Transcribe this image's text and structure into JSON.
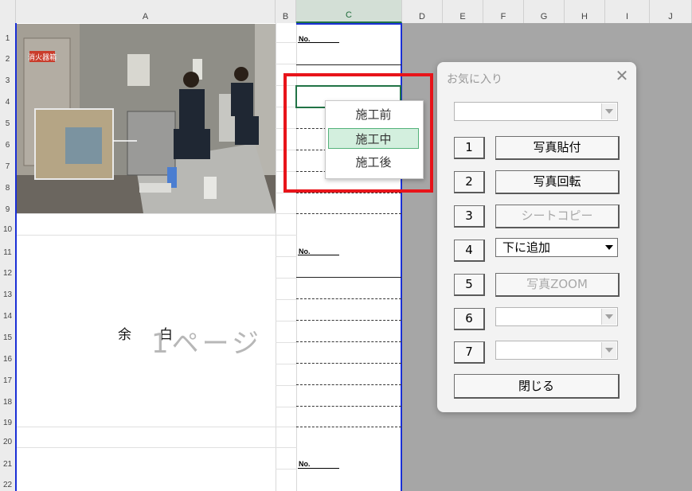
{
  "columns": [
    "A",
    "B",
    "C",
    "D",
    "E",
    "F",
    "G",
    "H",
    "I",
    "J"
  ],
  "rows": [
    "1",
    "2",
    "3",
    "4",
    "5",
    "6",
    "7",
    "8",
    "9",
    "10",
    "11",
    "12",
    "13",
    "14",
    "15",
    "16",
    "17",
    "18",
    "19",
    "20",
    "21",
    "22"
  ],
  "photo_sign": "消火器箱",
  "no_label": "No.",
  "yohaku_left": "余",
  "yohaku_right": "白",
  "page_text": "1ページ",
  "dropdown": {
    "items": [
      "施工前",
      "施工中",
      "施工後"
    ],
    "highlighted": "施工中"
  },
  "form": {
    "title": "お気に入り",
    "top_combo_value": "",
    "rows": [
      {
        "num": "1",
        "type": "button",
        "label": "写真貼付",
        "enabled": true
      },
      {
        "num": "2",
        "type": "button",
        "label": "写真回転",
        "enabled": true
      },
      {
        "num": "3",
        "type": "button",
        "label": "シートコピー",
        "enabled": false
      },
      {
        "num": "4",
        "type": "combo",
        "label": "下に追加",
        "enabled": true
      },
      {
        "num": "5",
        "type": "button",
        "label": "写真ZOOM",
        "enabled": false
      },
      {
        "num": "6",
        "type": "combo",
        "label": "",
        "enabled": false
      },
      {
        "num": "7",
        "type": "combo",
        "label": "",
        "enabled": false
      }
    ],
    "close_label": "閉じる"
  },
  "colors": {
    "selection_green": "#217346",
    "highlight_red": "#e8141a",
    "page_border_blue": "#1a2fd6"
  }
}
